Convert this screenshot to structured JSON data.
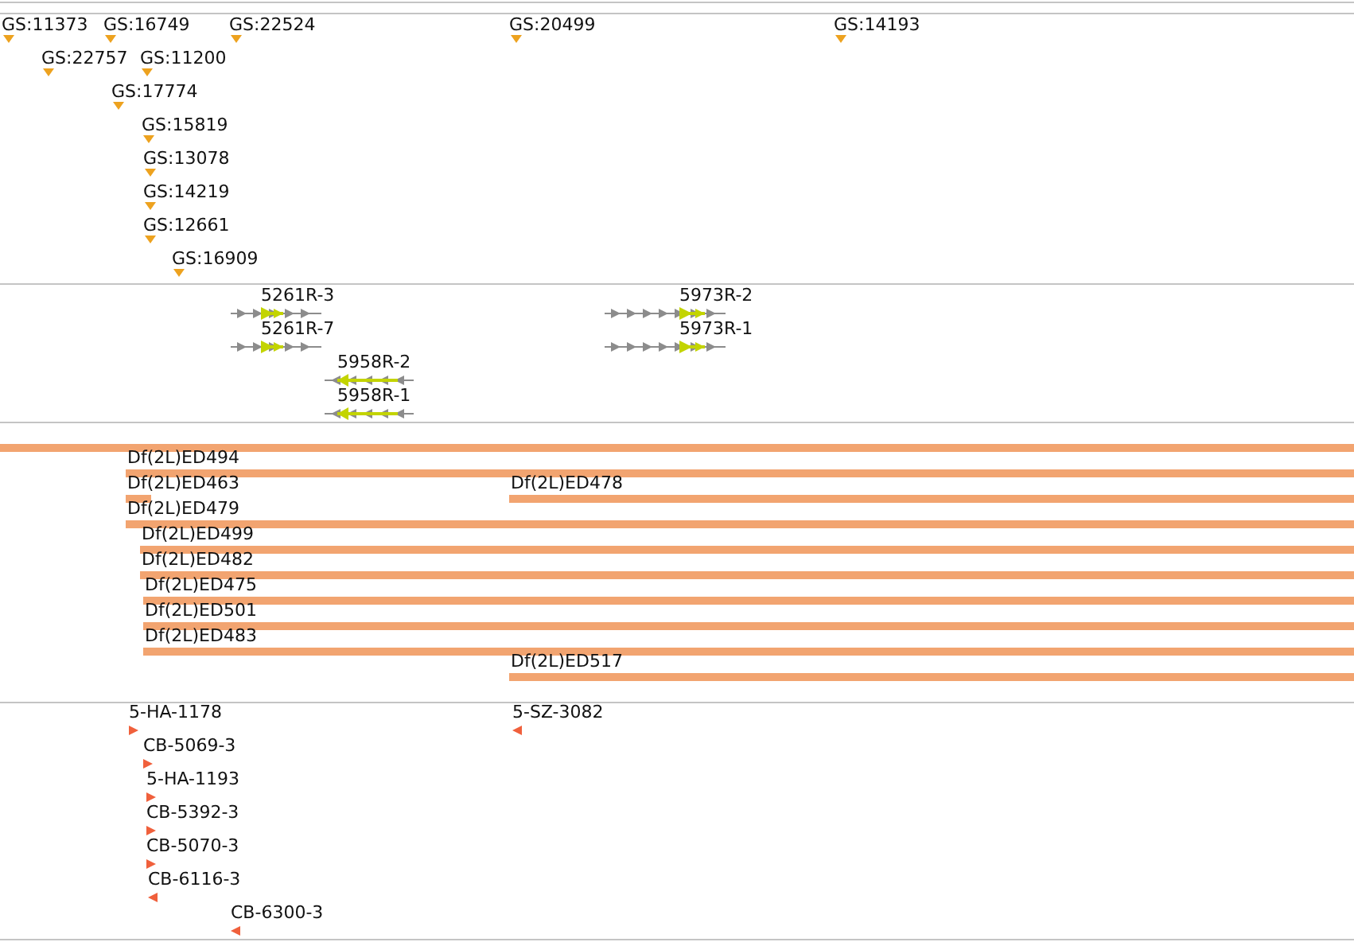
{
  "gene_track": {
    "features": [
      {
        "label": "GS:11373"
      },
      {
        "label": "GS:16749"
      },
      {
        "label": "GS:22524"
      },
      {
        "label": "GS:20499"
      },
      {
        "label": "GS:14193"
      },
      {
        "label": "GS:22757"
      },
      {
        "label": "GS:11200"
      },
      {
        "label": "GS:17774"
      },
      {
        "label": "GS:15819"
      },
      {
        "label": "GS:13078"
      },
      {
        "label": "GS:14219"
      },
      {
        "label": "GS:12661"
      },
      {
        "label": "GS:16909"
      }
    ]
  },
  "transcript_track": {
    "transcripts": [
      {
        "label": "5261R-3",
        "reverse": false
      },
      {
        "label": "5973R-2",
        "reverse": false
      },
      {
        "label": "5261R-7",
        "reverse": false
      },
      {
        "label": "5973R-1",
        "reverse": false
      },
      {
        "label": "5958R-2",
        "reverse": true
      },
      {
        "label": "5958R-1",
        "reverse": true
      }
    ]
  },
  "deficiency_track": {
    "deficiencies": [
      {
        "kind": "unlabeled"
      },
      {
        "kind": "labeled",
        "label": "Df(2L)ED494"
      },
      {
        "kind": "labeled",
        "label": "Df(2L)ED463"
      },
      {
        "kind": "labeled",
        "label": "Df(2L)ED478"
      },
      {
        "kind": "labeled",
        "label": "Df(2L)ED479"
      },
      {
        "kind": "labeled",
        "label": "Df(2L)ED499"
      },
      {
        "kind": "labeled",
        "label": "Df(2L)ED482"
      },
      {
        "kind": "labeled",
        "label": "Df(2L)ED475"
      },
      {
        "kind": "labeled",
        "label": "Df(2L)ED501"
      },
      {
        "kind": "labeled",
        "label": "Df(2L)ED483"
      },
      {
        "kind": "labeled",
        "label": "Df(2L)ED517"
      }
    ]
  },
  "insertion_track": {
    "insertions": [
      {
        "label": "5-HA-1178",
        "reverse": false
      },
      {
        "label": "5-SZ-3082",
        "reverse": true
      },
      {
        "label": "CB-5069-3",
        "reverse": false
      },
      {
        "label": "5-HA-1193",
        "reverse": false
      },
      {
        "label": "CB-5392-3",
        "reverse": false
      },
      {
        "label": "CB-5070-3",
        "reverse": false
      },
      {
        "label": "CB-6116-3",
        "reverse": true
      },
      {
        "label": "CB-6300-3",
        "reverse": true
      }
    ]
  }
}
